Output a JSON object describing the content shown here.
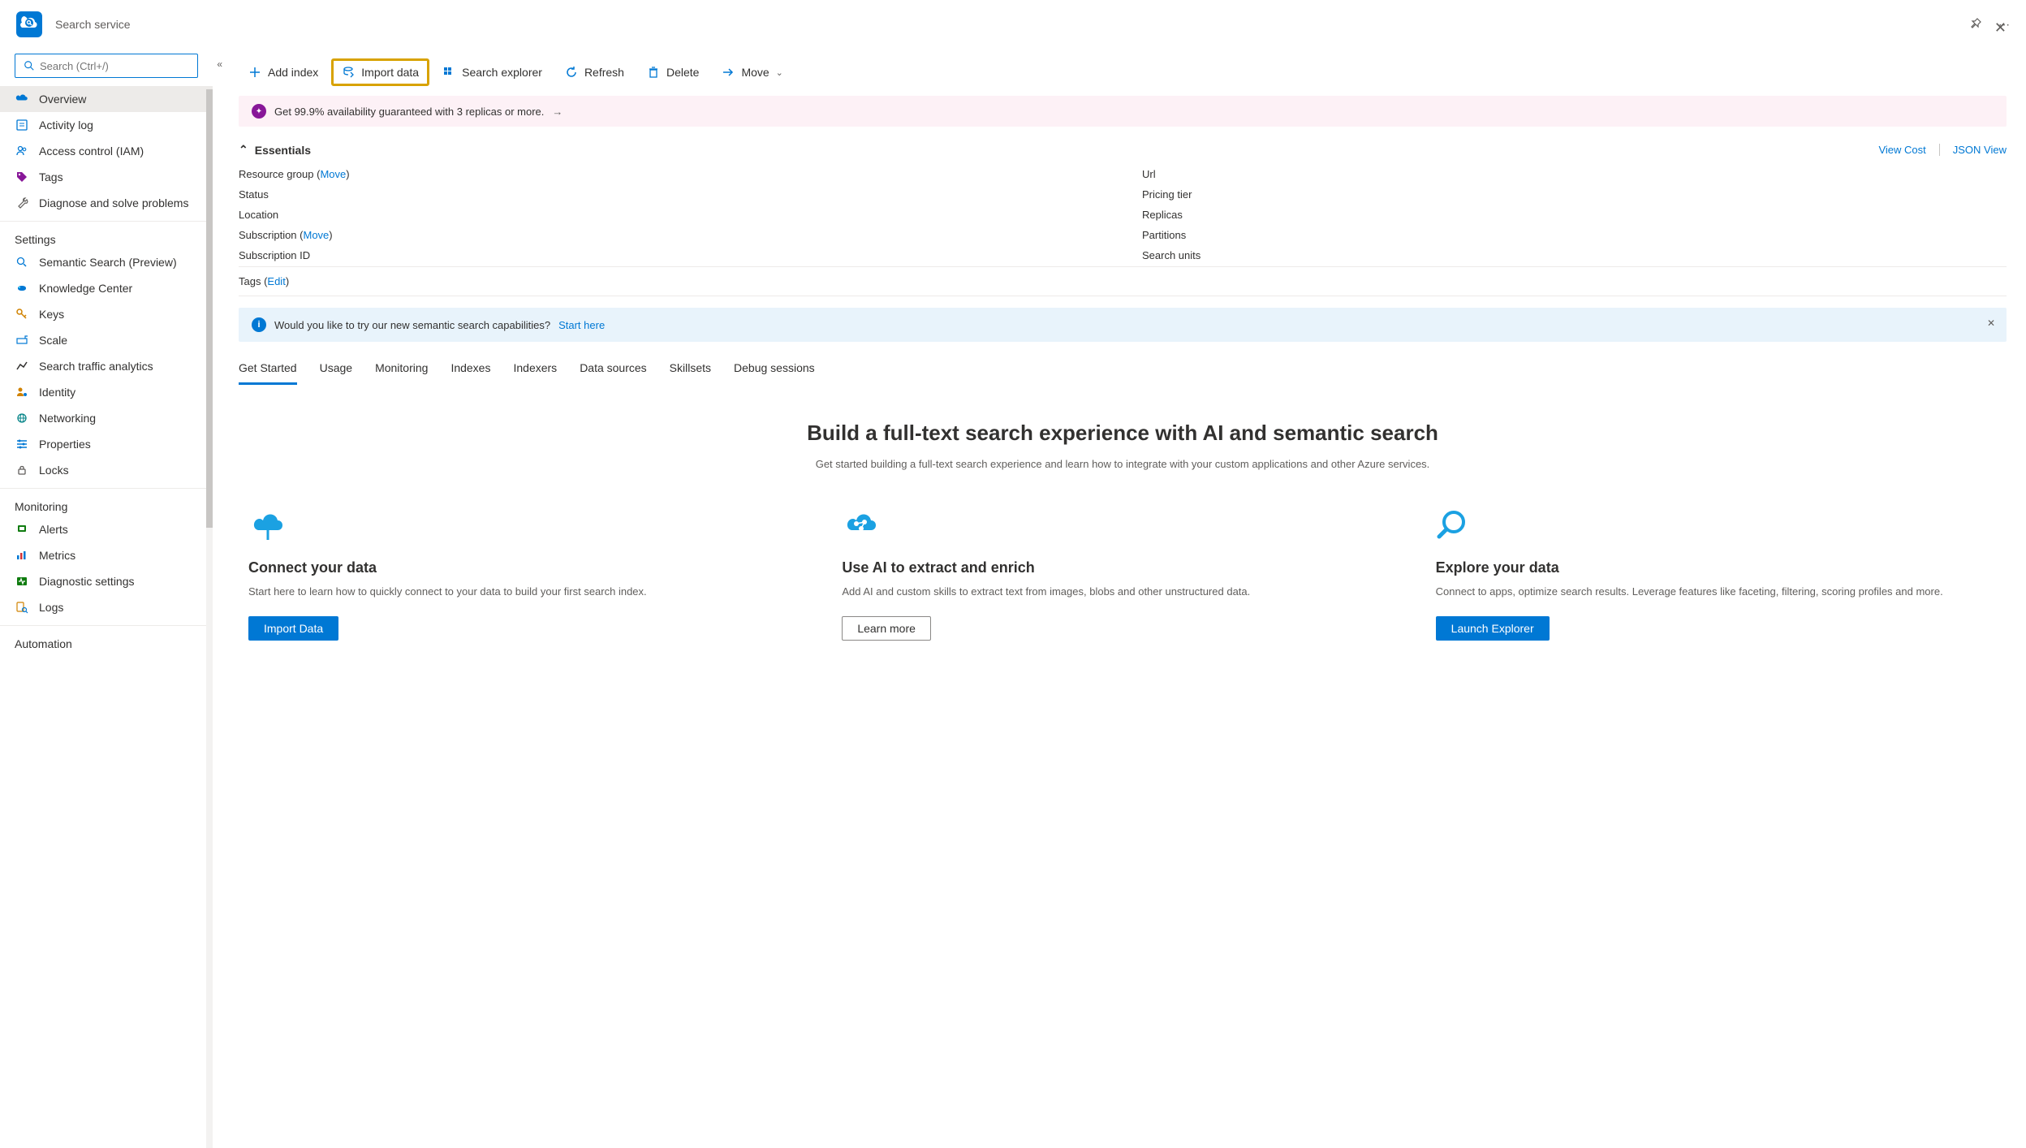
{
  "header": {
    "title": "Search service"
  },
  "search": {
    "placeholder": "Search (Ctrl+/)"
  },
  "sidebar": {
    "items": [
      {
        "label": "Overview"
      },
      {
        "label": "Activity log"
      },
      {
        "label": "Access control (IAM)"
      },
      {
        "label": "Tags"
      },
      {
        "label": "Diagnose and solve problems"
      }
    ],
    "section_settings": "Settings",
    "settings_items": [
      {
        "label": "Semantic Search (Preview)"
      },
      {
        "label": "Knowledge Center"
      },
      {
        "label": "Keys"
      },
      {
        "label": "Scale"
      },
      {
        "label": "Search traffic analytics"
      },
      {
        "label": "Identity"
      },
      {
        "label": "Networking"
      },
      {
        "label": "Properties"
      },
      {
        "label": "Locks"
      }
    ],
    "section_monitoring": "Monitoring",
    "monitoring_items": [
      {
        "label": "Alerts"
      },
      {
        "label": "Metrics"
      },
      {
        "label": "Diagnostic settings"
      },
      {
        "label": "Logs"
      }
    ],
    "section_automation": "Automation"
  },
  "toolbar": {
    "add_index": "Add index",
    "import_data": "Import data",
    "search_explorer": "Search explorer",
    "refresh": "Refresh",
    "delete": "Delete",
    "move": "Move"
  },
  "banner": {
    "message": "Get 99.9% availability guaranteed with 3 replicas or more."
  },
  "essentials": {
    "title": "Essentials",
    "view_cost": "View Cost",
    "json_view": "JSON View",
    "resource_group_label": "Resource group (",
    "resource_group_move": "Move",
    "status_label": "Status",
    "location_label": "Location",
    "subscription_label": "Subscription (",
    "subscription_move": "Move",
    "subscription_id_label": "Subscription ID",
    "url_label": "Url",
    "pricing_tier_label": "Pricing tier",
    "replicas_label": "Replicas",
    "partitions_label": "Partitions",
    "search_units_label": "Search units",
    "tags_label": "Tags (",
    "tags_edit": "Edit"
  },
  "info_banner": {
    "message": "Would you like to try our new semantic search capabilities? ",
    "link": "Start here"
  },
  "tabs": [
    {
      "label": "Get Started"
    },
    {
      "label": "Usage"
    },
    {
      "label": "Monitoring"
    },
    {
      "label": "Indexes"
    },
    {
      "label": "Indexers"
    },
    {
      "label": "Data sources"
    },
    {
      "label": "Skillsets"
    },
    {
      "label": "Debug sessions"
    }
  ],
  "hero": {
    "title": "Build a full-text search experience with AI and semantic search",
    "subtitle": "Get started building a full-text search experience and learn how to integrate with your custom applications and other Azure services."
  },
  "cards": [
    {
      "title": "Connect your data",
      "desc": "Start here to learn how to quickly connect to your data to build your first search index.",
      "button": "Import Data",
      "btn_style": "primary"
    },
    {
      "title": "Use AI to extract and enrich",
      "desc": "Add AI and custom skills to extract text from images, blobs and other unstructured data.",
      "button": "Learn more",
      "btn_style": "secondary"
    },
    {
      "title": "Explore your data",
      "desc": "Connect to apps, optimize search results. Leverage features like faceting, filtering, scoring profiles and more.",
      "button": "Launch Explorer",
      "btn_style": "primary"
    }
  ]
}
